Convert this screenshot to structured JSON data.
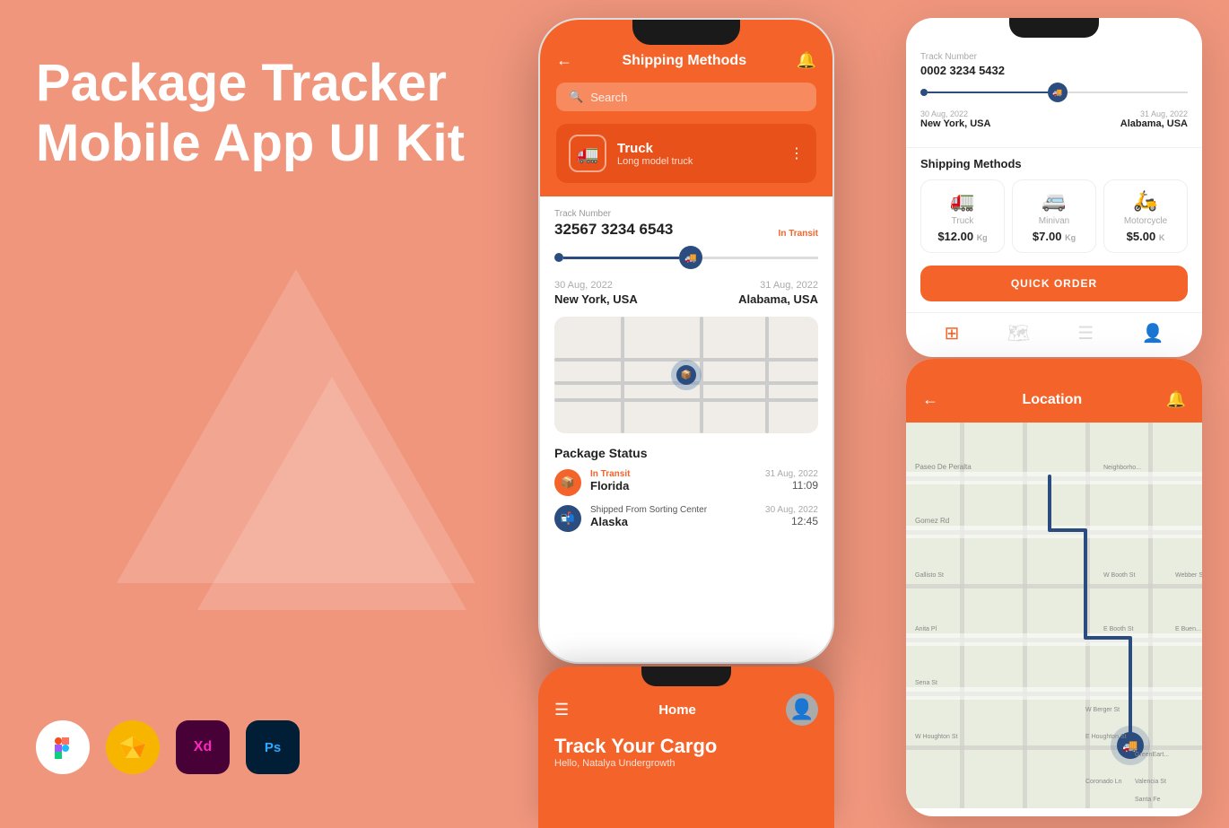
{
  "background": "#F0967D",
  "title": {
    "line1": "Package Tracker",
    "line2": "Mobile App UI Kit"
  },
  "tools": [
    {
      "name": "Figma",
      "bg": "#fff",
      "color": "#F24E1E",
      "letter": "F"
    },
    {
      "name": "Sketch",
      "bg": "#F7B500",
      "color": "#fff",
      "letter": "S"
    },
    {
      "name": "XD",
      "bg": "#470137",
      "color": "#FF26BE",
      "letter": "Xd"
    },
    {
      "name": "Photoshop",
      "bg": "#001E36",
      "color": "#31A8FF",
      "letter": "Ps"
    }
  ],
  "center_phone": {
    "header_title": "Shipping Methods",
    "search_placeholder": "Search",
    "truck_name": "Truck",
    "truck_sub": "Long model truck",
    "track_label": "Track Number",
    "track_number": "32567 3234 6543",
    "in_transit": "In Transit",
    "date_from": "30 Aug, 2022",
    "date_to": "31 Aug, 2022",
    "city_from": "New York, USA",
    "city_to": "Alabama, USA",
    "status_title": "Package Status",
    "status_items": [
      {
        "label": "In Transit",
        "date": "31 Aug, 2022",
        "location": "Florida",
        "time": "11:09",
        "type": "orange"
      },
      {
        "label": "Shipped From Sorting Center",
        "date": "30 Aug, 2022",
        "location": "Alaska",
        "time": "12:45",
        "type": "blue"
      }
    ]
  },
  "right_top": {
    "tracking_number": "0002 3234 5432",
    "date_from": "30 Aug, 2022",
    "date_to": "31 Aug, 2022",
    "city_from": "New York, USA",
    "city_to": "Alabama, USA",
    "shipping_methods_title": "Shipping Methods",
    "methods": [
      {
        "name": "Truck",
        "price": "$12.00",
        "unit": "Kg",
        "icon": "🚛"
      },
      {
        "name": "Minivan",
        "price": "$7.00",
        "unit": "Kg",
        "icon": "🚐"
      },
      {
        "name": "Motorcycle",
        "price": "$5.00",
        "unit": "K",
        "icon": "🛵"
      }
    ],
    "quick_order_label": "QUICK ORDER",
    "nav_icons": [
      "grid",
      "map",
      "list",
      "user"
    ]
  },
  "right_bottom": {
    "title": "Location"
  },
  "bottom_phone": {
    "home_title": "Home",
    "heading": "Track Your Cargo",
    "sub": "Hello, Natalya Undergrowth"
  }
}
